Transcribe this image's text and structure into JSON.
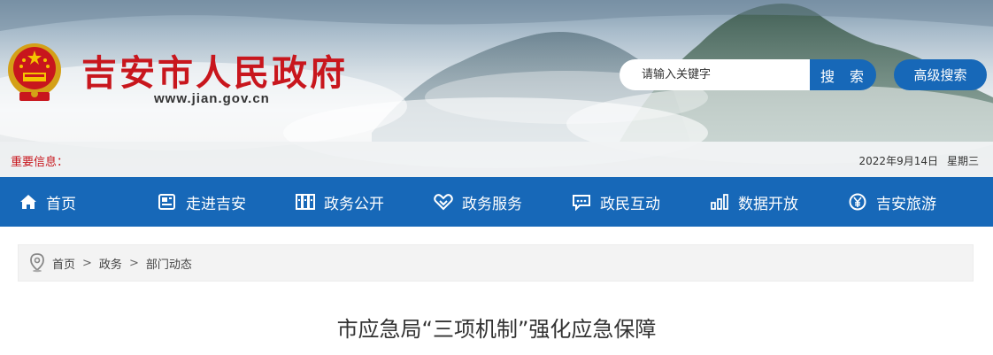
{
  "header": {
    "site_title": "吉安市人民政府",
    "site_url": "www.jian.gov.cn"
  },
  "search": {
    "placeholder": "请输入关键字",
    "button_label": "搜 索",
    "advanced_label": "高级搜索"
  },
  "notice": {
    "label": "重要信息：",
    "date": "2022年9月14日",
    "weekday": "星期三"
  },
  "nav": {
    "items": [
      {
        "label": "首页",
        "icon": "home-icon"
      },
      {
        "label": "走进吉安",
        "icon": "document-icon"
      },
      {
        "label": "政务公开",
        "icon": "folders-icon"
      },
      {
        "label": "政务服务",
        "icon": "handshake-icon"
      },
      {
        "label": "政民互动",
        "icon": "chat-icon"
      },
      {
        "label": "数据开放",
        "icon": "bar-chart-icon"
      },
      {
        "label": "吉安旅游",
        "icon": "yuan-coin-icon"
      }
    ]
  },
  "breadcrumb": {
    "items": [
      "首页",
      "政务",
      "部门动态"
    ],
    "separator": ">"
  },
  "article": {
    "title": "市应急局“三项机制”强化应急保障"
  },
  "colors": {
    "brand_red": "#c8161d",
    "nav_blue": "#1768b8"
  }
}
